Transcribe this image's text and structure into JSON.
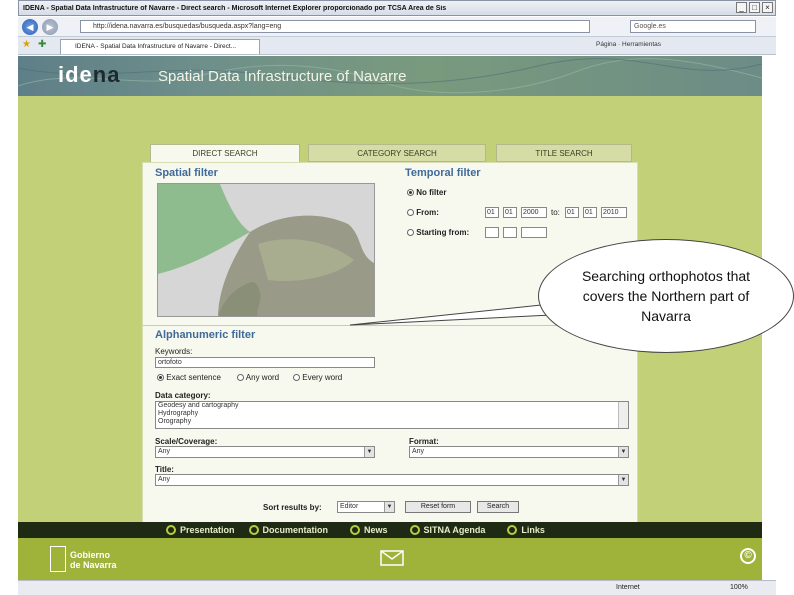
{
  "browser": {
    "window_title": "IDENA - Spatial Data Infrastructure of Navarre - Direct search - Microsoft Internet Explorer proporcionado por TCSA Area de Sis",
    "url": "http://idena.navarra.es/busquedas/busqueda.aspx?lang=eng",
    "search_box": "Google.es",
    "tab_title": "IDENA - Spatial Data Infrastructure of Navarre - Direct...",
    "toolbar_right": "Página · Herramientas",
    "status_zone": "Internet",
    "zoom": "100%"
  },
  "header": {
    "logo_main": "ide",
    "logo_accent": "na",
    "tagline": "Spatial Data Infrastructure of Navarre"
  },
  "tabs": [
    {
      "label": "DIRECT SEARCH",
      "active": true
    },
    {
      "label": "CATEGORY SEARCH",
      "active": false
    },
    {
      "label": "TITLE SEARCH",
      "active": false
    }
  ],
  "spatial_filter": {
    "title": "Spatial filter"
  },
  "temporal_filter": {
    "title": "Temporal filter",
    "no_filter": "No filter",
    "from": "From:",
    "to": "to:",
    "starting_from": "Starting from:",
    "from_date": [
      "01",
      "01",
      "2000"
    ],
    "to_date": [
      "01",
      "01",
      "2010"
    ]
  },
  "alphanumeric": {
    "title": "Alphanumeric filter",
    "keywords_label": "Keywords:",
    "keywords_value": "ortofoto",
    "exact_sentence": "Exact sentence",
    "any_word": "Any word",
    "every_word": "Every word",
    "data_category_label": "Data category:",
    "categories": [
      "Geodesy and cartography",
      "Hydrography",
      "Orography"
    ],
    "scale_label": "Scale/Coverage:",
    "scale_value": "Any",
    "format_label": "Format:",
    "format_value": "Any",
    "title_label": "Title:",
    "title_value": "Any"
  },
  "actions": {
    "sort_label": "Sort results by:",
    "sort_value": "Editor",
    "reset_button": "Reset form",
    "search_button": "Search"
  },
  "callout": {
    "text": "Searching orthophotos that covers the Northern part of Navarra"
  },
  "footer": {
    "nav": [
      "Presentation",
      "Documentation",
      "News",
      "SITNA Agenda",
      "Links"
    ],
    "gov_line1": "Gobierno",
    "gov_line2": "de Navarra",
    "copyright": "©"
  }
}
